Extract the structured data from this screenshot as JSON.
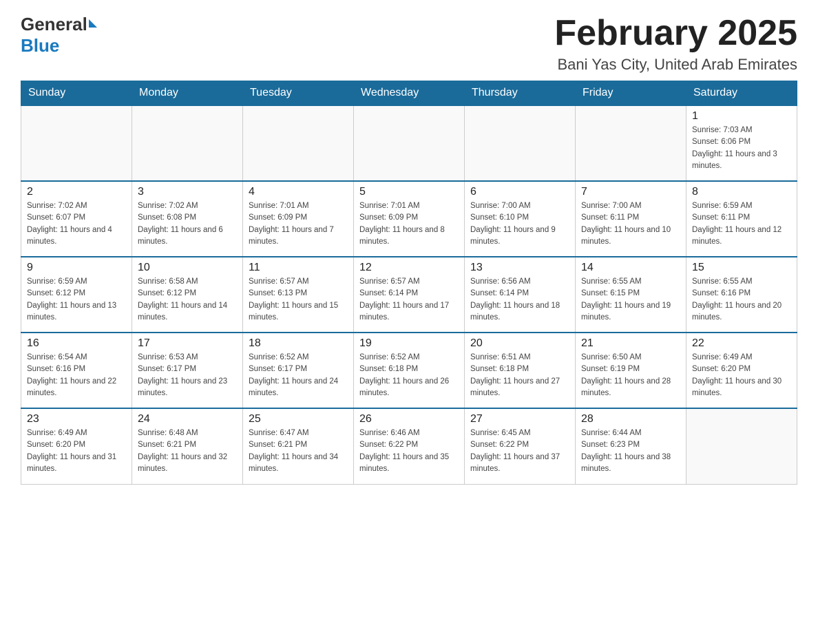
{
  "logo": {
    "general": "General",
    "blue": "Blue"
  },
  "title": "February 2025",
  "subtitle": "Bani Yas City, United Arab Emirates",
  "days_of_week": [
    "Sunday",
    "Monday",
    "Tuesday",
    "Wednesday",
    "Thursday",
    "Friday",
    "Saturday"
  ],
  "weeks": [
    [
      {
        "day": "",
        "info": ""
      },
      {
        "day": "",
        "info": ""
      },
      {
        "day": "",
        "info": ""
      },
      {
        "day": "",
        "info": ""
      },
      {
        "day": "",
        "info": ""
      },
      {
        "day": "",
        "info": ""
      },
      {
        "day": "1",
        "info": "Sunrise: 7:03 AM\nSunset: 6:06 PM\nDaylight: 11 hours and 3 minutes."
      }
    ],
    [
      {
        "day": "2",
        "info": "Sunrise: 7:02 AM\nSunset: 6:07 PM\nDaylight: 11 hours and 4 minutes."
      },
      {
        "day": "3",
        "info": "Sunrise: 7:02 AM\nSunset: 6:08 PM\nDaylight: 11 hours and 6 minutes."
      },
      {
        "day": "4",
        "info": "Sunrise: 7:01 AM\nSunset: 6:09 PM\nDaylight: 11 hours and 7 minutes."
      },
      {
        "day": "5",
        "info": "Sunrise: 7:01 AM\nSunset: 6:09 PM\nDaylight: 11 hours and 8 minutes."
      },
      {
        "day": "6",
        "info": "Sunrise: 7:00 AM\nSunset: 6:10 PM\nDaylight: 11 hours and 9 minutes."
      },
      {
        "day": "7",
        "info": "Sunrise: 7:00 AM\nSunset: 6:11 PM\nDaylight: 11 hours and 10 minutes."
      },
      {
        "day": "8",
        "info": "Sunrise: 6:59 AM\nSunset: 6:11 PM\nDaylight: 11 hours and 12 minutes."
      }
    ],
    [
      {
        "day": "9",
        "info": "Sunrise: 6:59 AM\nSunset: 6:12 PM\nDaylight: 11 hours and 13 minutes."
      },
      {
        "day": "10",
        "info": "Sunrise: 6:58 AM\nSunset: 6:12 PM\nDaylight: 11 hours and 14 minutes."
      },
      {
        "day": "11",
        "info": "Sunrise: 6:57 AM\nSunset: 6:13 PM\nDaylight: 11 hours and 15 minutes."
      },
      {
        "day": "12",
        "info": "Sunrise: 6:57 AM\nSunset: 6:14 PM\nDaylight: 11 hours and 17 minutes."
      },
      {
        "day": "13",
        "info": "Sunrise: 6:56 AM\nSunset: 6:14 PM\nDaylight: 11 hours and 18 minutes."
      },
      {
        "day": "14",
        "info": "Sunrise: 6:55 AM\nSunset: 6:15 PM\nDaylight: 11 hours and 19 minutes."
      },
      {
        "day": "15",
        "info": "Sunrise: 6:55 AM\nSunset: 6:16 PM\nDaylight: 11 hours and 20 minutes."
      }
    ],
    [
      {
        "day": "16",
        "info": "Sunrise: 6:54 AM\nSunset: 6:16 PM\nDaylight: 11 hours and 22 minutes."
      },
      {
        "day": "17",
        "info": "Sunrise: 6:53 AM\nSunset: 6:17 PM\nDaylight: 11 hours and 23 minutes."
      },
      {
        "day": "18",
        "info": "Sunrise: 6:52 AM\nSunset: 6:17 PM\nDaylight: 11 hours and 24 minutes."
      },
      {
        "day": "19",
        "info": "Sunrise: 6:52 AM\nSunset: 6:18 PM\nDaylight: 11 hours and 26 minutes."
      },
      {
        "day": "20",
        "info": "Sunrise: 6:51 AM\nSunset: 6:18 PM\nDaylight: 11 hours and 27 minutes."
      },
      {
        "day": "21",
        "info": "Sunrise: 6:50 AM\nSunset: 6:19 PM\nDaylight: 11 hours and 28 minutes."
      },
      {
        "day": "22",
        "info": "Sunrise: 6:49 AM\nSunset: 6:20 PM\nDaylight: 11 hours and 30 minutes."
      }
    ],
    [
      {
        "day": "23",
        "info": "Sunrise: 6:49 AM\nSunset: 6:20 PM\nDaylight: 11 hours and 31 minutes."
      },
      {
        "day": "24",
        "info": "Sunrise: 6:48 AM\nSunset: 6:21 PM\nDaylight: 11 hours and 32 minutes."
      },
      {
        "day": "25",
        "info": "Sunrise: 6:47 AM\nSunset: 6:21 PM\nDaylight: 11 hours and 34 minutes."
      },
      {
        "day": "26",
        "info": "Sunrise: 6:46 AM\nSunset: 6:22 PM\nDaylight: 11 hours and 35 minutes."
      },
      {
        "day": "27",
        "info": "Sunrise: 6:45 AM\nSunset: 6:22 PM\nDaylight: 11 hours and 37 minutes."
      },
      {
        "day": "28",
        "info": "Sunrise: 6:44 AM\nSunset: 6:23 PM\nDaylight: 11 hours and 38 minutes."
      },
      {
        "day": "",
        "info": ""
      }
    ]
  ]
}
